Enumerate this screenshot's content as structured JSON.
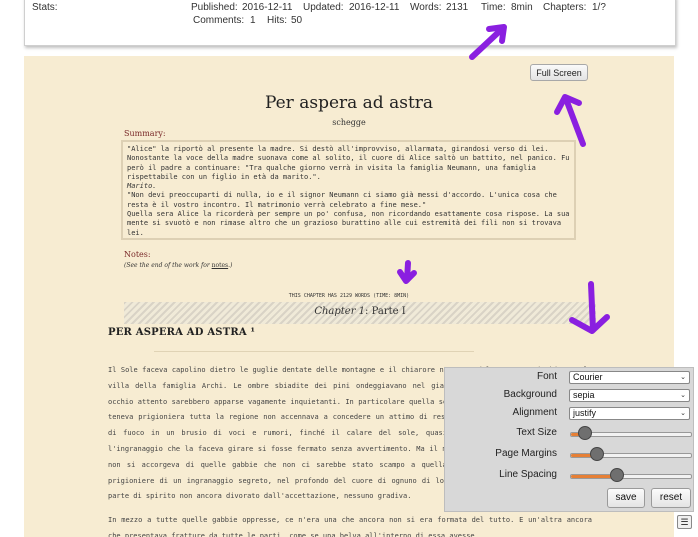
{
  "stats": {
    "label": "Stats:",
    "published_label": "Published:",
    "published": "2016-12-11",
    "updated_label": "Updated:",
    "updated": "2016-12-11",
    "words_label": "Words:",
    "words": "2131",
    "time_label": "Time:",
    "time": "8min",
    "chapters_label": "Chapters:",
    "chapters": "1/?",
    "comments_label": "Comments:",
    "comments": "1",
    "hits_label": "Hits:",
    "hits": "50"
  },
  "work": {
    "full_screen_label": "Full Screen",
    "title": "Per aspera ad astra",
    "author": "schegge",
    "summary_heading": "Summary:",
    "summary": [
      {
        "text": "\"Alice\" la riportò al presente la madre. Si destò all'improvviso, allarmata, girandosi verso di lei. Nonostante la voce della madre suonava come al solito, il cuore di Alice saltò un battito, nel panico. Fu però il padre a continuare: \"Tra qualche giorno verrà in visita la famiglia Neumann, una famiglia rispettabile con un figlio in età da marito.\".",
        "italic": false
      },
      {
        "text": "Marito.",
        "italic": true
      },
      {
        "text": "\"Non devi preoccuparti di nulla, io e il signor Neumann ci siamo già messi d'accordo. L'unica cosa che resta è il vostro incontro. Il matrimonio verrà celebrato a fine mese.\"",
        "italic": false
      },
      {
        "text": "Quella sera Alice la ricorderà per sempre un po' confusa, non ricordando esattamente cosa rispose. La sua mente si svuotò e non rimase altro che un grazioso burattino alle cui estremità dei fili non si trovava lei.",
        "italic": false
      }
    ],
    "notes_heading": "Notes:",
    "notes_prefix": "(See the end of the work for ",
    "notes_link": "notes",
    "notes_suffix": ".)",
    "chapter_wordcount": "THIS CHAPTER HAS 2129 WORDS (TIME: 8MIN)",
    "chapter_label": "Chapter 1",
    "chapter_name": ": Parte I",
    "chapter_heading": "PER ASPERA AD ASTRA ¹",
    "paragraphs": [
      "Il Sole faceva capolino dietro le guglie dentate delle montagne e il chiarore nascente del tramonto rischiarava la villa della famiglia Archi. Le ombre sbiadite dei pini ondeggiavano nel giardino, figure indistinte che a un occhio attento sarebbero apparse vagamente inquietanti. In particolare quella sera la cappa di caldo che da giorni teneva prigioniera tutta la regione non accennava a concedere un attimo di respiro agli abitanti. La regione era di fuoco in un brusio di voci e rumori, finché il calare del sole, quasi all'improvviso, taceva, come se l'ingranaggio che la faceva girare si fosse fermato senza avvertimento. Ma il mondo non si fermava, semplicemente non si accorgeva di quelle gabbie che non ci sarebbe stato scampo a quella messinscena. Le loro vite erano prigioniere di un ingranaggio segreto, nel profondo del cuore di ognuno di loro, stringendo a sé quella piccola parte di spirito non ancora divorato dall'accettazione, nessuno gradiva.",
      "In mezzo a tutte quelle gabbie oppresse, ce n'era una che ancora non si era formata del tutto. E un'altra ancora che presentava fratture da tutte le parti, come se una belva all'interno di essa avesse"
    ]
  },
  "settings": {
    "font_label": "Font",
    "font_value": "Courier",
    "background_label": "Background",
    "background_value": "sepia",
    "alignment_label": "Alignment",
    "alignment_value": "justify",
    "text_size_label": "Text Size",
    "text_size_level": 0.12,
    "page_margins_label": "Page Margins",
    "page_margins_level": 0.22,
    "line_spacing_label": "Line Spacing",
    "line_spacing_level": 0.38,
    "save_label": "save",
    "reset_label": "reset",
    "toggle_icon": "☰"
  },
  "colors": {
    "annotation_arrow": "#8a1fe0",
    "slider_fill": "#e67f35",
    "page_background": "#f7ecd2"
  }
}
